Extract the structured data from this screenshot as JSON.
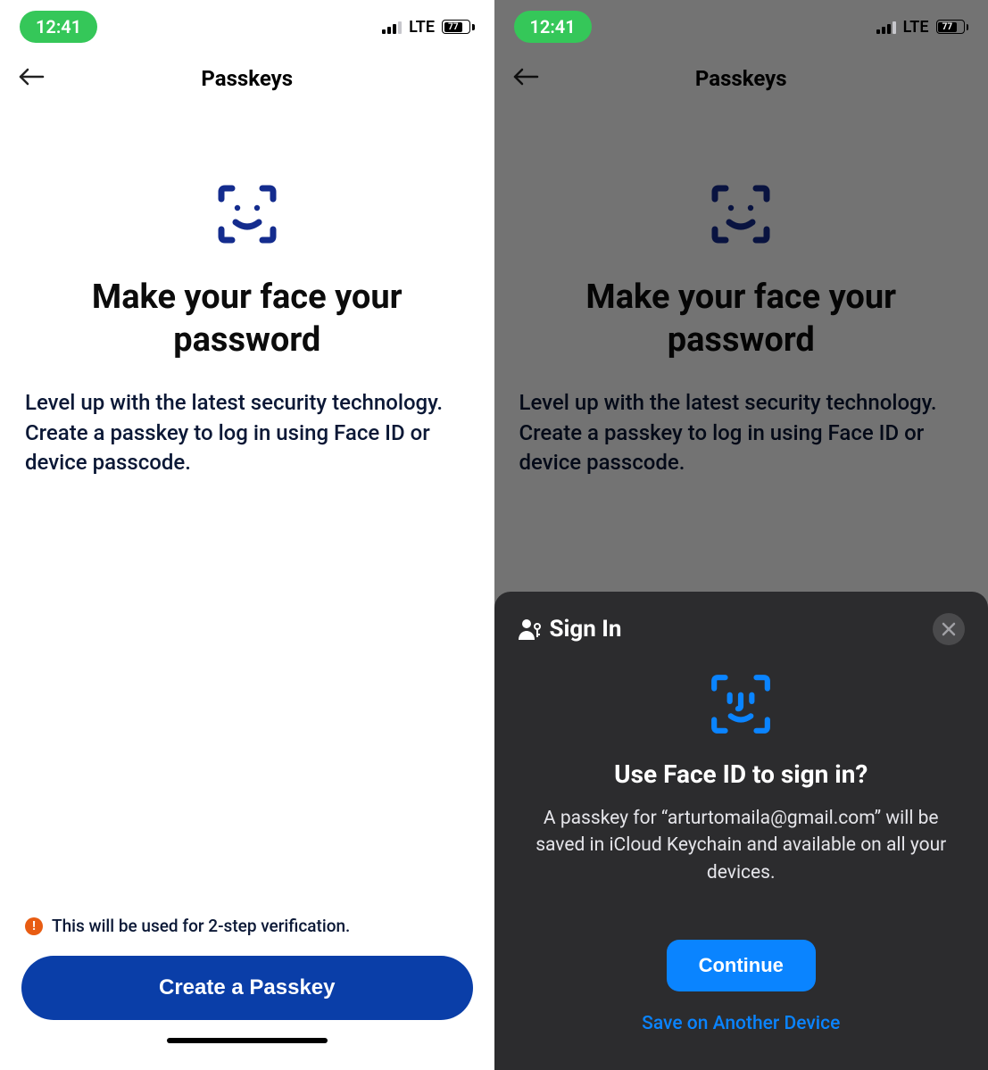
{
  "statusbar": {
    "time": "12:41",
    "network_label": "LTE",
    "battery_percent": "77"
  },
  "nav": {
    "title": "Passkeys",
    "back_icon": "back-arrow-icon"
  },
  "hero": {
    "headline": "Make your face your password",
    "body": "Level up with the latest security technology. Create a passkey to log in using Face ID or device passcode.",
    "icon": "face-id-icon"
  },
  "notice": {
    "icon": "alert-icon",
    "text": "This will be used for 2-step verification."
  },
  "cta": {
    "label": "Create a Passkey"
  },
  "sheet": {
    "header_label": "Sign In",
    "header_icon": "person-key-icon",
    "close_icon": "close-icon",
    "faceid_icon": "face-id-icon",
    "title": "Use Face ID to sign in?",
    "body": "A passkey for “arturtomaila@gmail.com” will be saved in iCloud Keychain and available on all your devices.",
    "continue_label": "Continue",
    "alt_label": "Save on Another Device"
  }
}
